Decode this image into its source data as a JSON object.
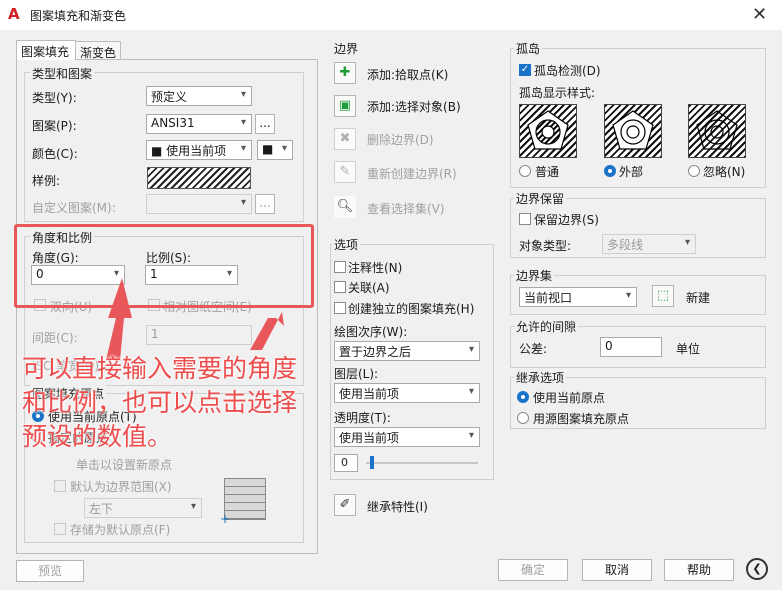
{
  "window": {
    "title": "图案填充和渐变色",
    "app_icon": "autocad-a-icon",
    "close_glyph": "✕"
  },
  "tabs": [
    {
      "label": "图案填充"
    },
    {
      "label": "渐变色"
    }
  ],
  "type_pattern": {
    "group_label": "类型和图案",
    "type_label": "类型(Y):",
    "type_value": "预定义",
    "pattern_label": "图案(P):",
    "pattern_value": "ANSI31",
    "browse_label": "...",
    "color_label": "颜色(C):",
    "color_value": "■ 使用当前项",
    "color2_value": "■",
    "sample_label": "样例:",
    "custom_label": "自定义图案(M):",
    "custom_browse": "..."
  },
  "angle_scale": {
    "group_label": "角度和比例",
    "angle_label": "角度(G):",
    "angle_value": "0",
    "scale_label": "比例(S):",
    "scale_value": "1",
    "double_label": "双向(U)",
    "relative_label": "相对图纸空间(E)",
    "spacing_label": "间距(C):",
    "spacing_value": "1",
    "iso_label": "ISO 笔宽(O):"
  },
  "origin": {
    "group_label": "图案填充原点",
    "use_current": "使用当前原点(T)",
    "specified": "指定的原点",
    "click_set": "单击以设置新原点",
    "default_extent": "默认为边界范围(X)",
    "position_value": "左下",
    "store_default": "存储为默认原点(F)"
  },
  "preview_button": "预览",
  "boundaries": {
    "group_label": "边界",
    "add_pick": "添加:拾取点(K)",
    "add_select": "添加:选择对象(B)",
    "remove": "删除边界(D)",
    "recreate": "重新创建边界(R)",
    "view_selection": "查看选择集(V)"
  },
  "options": {
    "group_label": "选项",
    "annotative": "注释性(N)",
    "associative": "关联(A)",
    "separate": "创建独立的图案填充(H)",
    "draw_order_label": "绘图次序(W):",
    "draw_order_value": "置于边界之后",
    "layer_label": "图层(L):",
    "layer_value": "使用当前项",
    "transparency_label": "透明度(T):",
    "transparency_value": "使用当前项",
    "transparency_number": "0"
  },
  "inherit_button": "继承特性(I)",
  "islands": {
    "group_label": "孤岛",
    "detection": "孤岛检测(D)",
    "display_label": "孤岛显示样式:",
    "normal": "普通",
    "outer": "外部",
    "ignore": "忽略(N)"
  },
  "retain": {
    "group_label": "边界保留",
    "retain_label": "保留边界(S)",
    "object_type_label": "对象类型:",
    "object_type_value": "多段线"
  },
  "boundary_set": {
    "group_label": "边界集",
    "value": "当前视口",
    "new_label": "新建"
  },
  "gap": {
    "group_label": "允许的间隙",
    "tolerance_label": "公差:",
    "tolerance_value": "0",
    "unit_label": "单位"
  },
  "inherit_options": {
    "group_label": "继承选项",
    "use_current": "使用当前原点",
    "use_source": "用源图案填充原点"
  },
  "footer": {
    "ok": "确定",
    "cancel": "取消",
    "help": "帮助",
    "more_glyph": "❮"
  },
  "annotation": {
    "line1": "可以直接输入需要的角度",
    "line2": "和比例，也可以点击选择",
    "line3": "预设的数值。",
    "color": "#ee4d4d"
  }
}
